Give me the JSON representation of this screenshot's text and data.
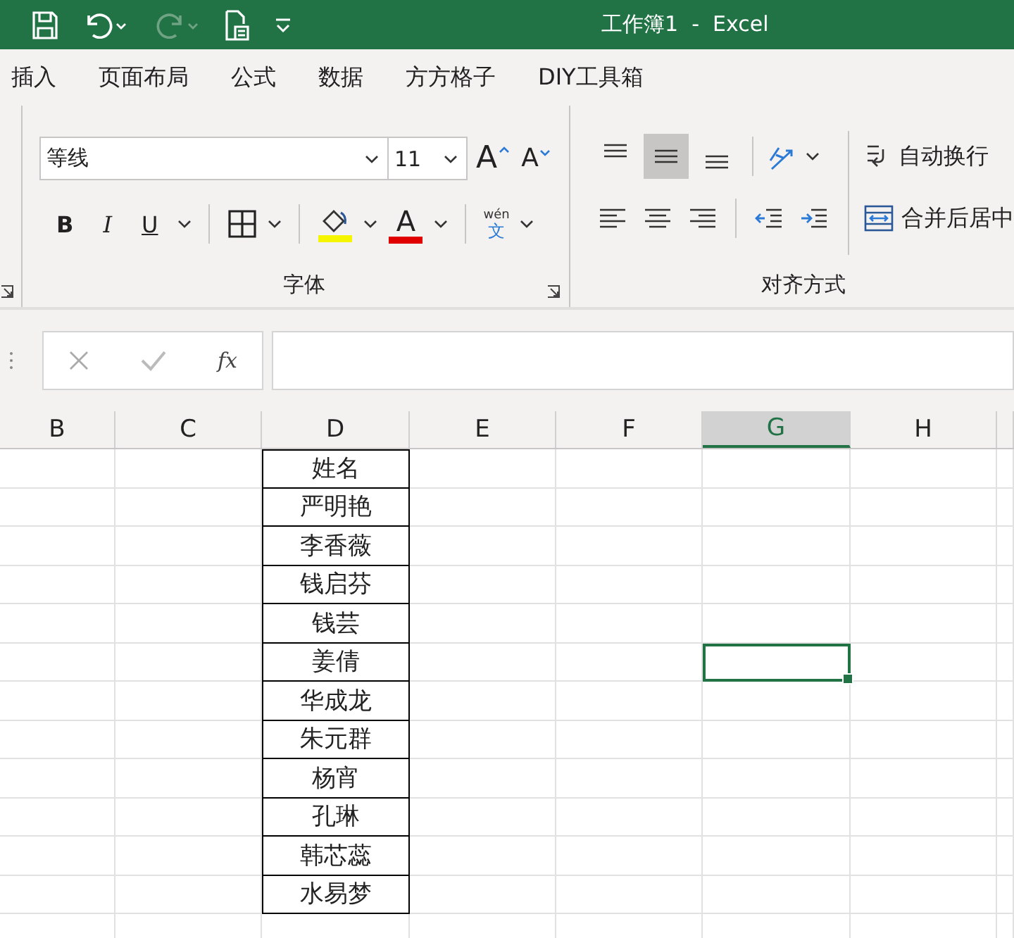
{
  "title_bar": {
    "title": "工作簿1  -  Excel"
  },
  "tabs": [
    {
      "label": "插入"
    },
    {
      "label": "页面布局"
    },
    {
      "label": "公式"
    },
    {
      "label": "数据"
    },
    {
      "label": "方方格子"
    },
    {
      "label": "DIY工具箱"
    }
  ],
  "font_group": {
    "font_name": "等线",
    "font_size": "11",
    "grow_font": "A",
    "shrink_font": "A",
    "styles": [
      "B",
      "I",
      "U"
    ],
    "font_color": "A",
    "phonetic_top": "wén",
    "phonetic_bottom": "文",
    "label": "字体"
  },
  "alignment_group": {
    "vertical_align": [
      {
        "selected": false
      },
      {
        "selected": true
      },
      {
        "selected": false
      }
    ],
    "wrap_text": "自动换行",
    "merge_center": "合并后居中",
    "label": "对齐方式"
  },
  "formula_bar": {
    "fx": "fx"
  },
  "columns": [
    {
      "label": "B",
      "selected": false
    },
    {
      "label": "C",
      "selected": false
    },
    {
      "label": "D",
      "selected": false
    },
    {
      "label": "E",
      "selected": false
    },
    {
      "label": "F",
      "selected": false
    },
    {
      "label": "G",
      "selected": true
    },
    {
      "label": "H",
      "selected": false
    }
  ],
  "rows": [
    {
      "name": "姓名",
      "active": false
    },
    {
      "name": "严明艳",
      "active": false
    },
    {
      "name": "李香薇",
      "active": false
    },
    {
      "name": "钱启芬",
      "active": false
    },
    {
      "name": "钱芸",
      "active": false
    },
    {
      "name": "姜倩",
      "active": true
    },
    {
      "name": "华成龙",
      "active": false
    },
    {
      "name": "朱元群",
      "active": false
    },
    {
      "name": "杨宵",
      "active": false
    },
    {
      "name": "孔琳",
      "active": false
    },
    {
      "name": "韩芯蕊",
      "active": false
    },
    {
      "name": "水易梦",
      "active": false
    }
  ]
}
